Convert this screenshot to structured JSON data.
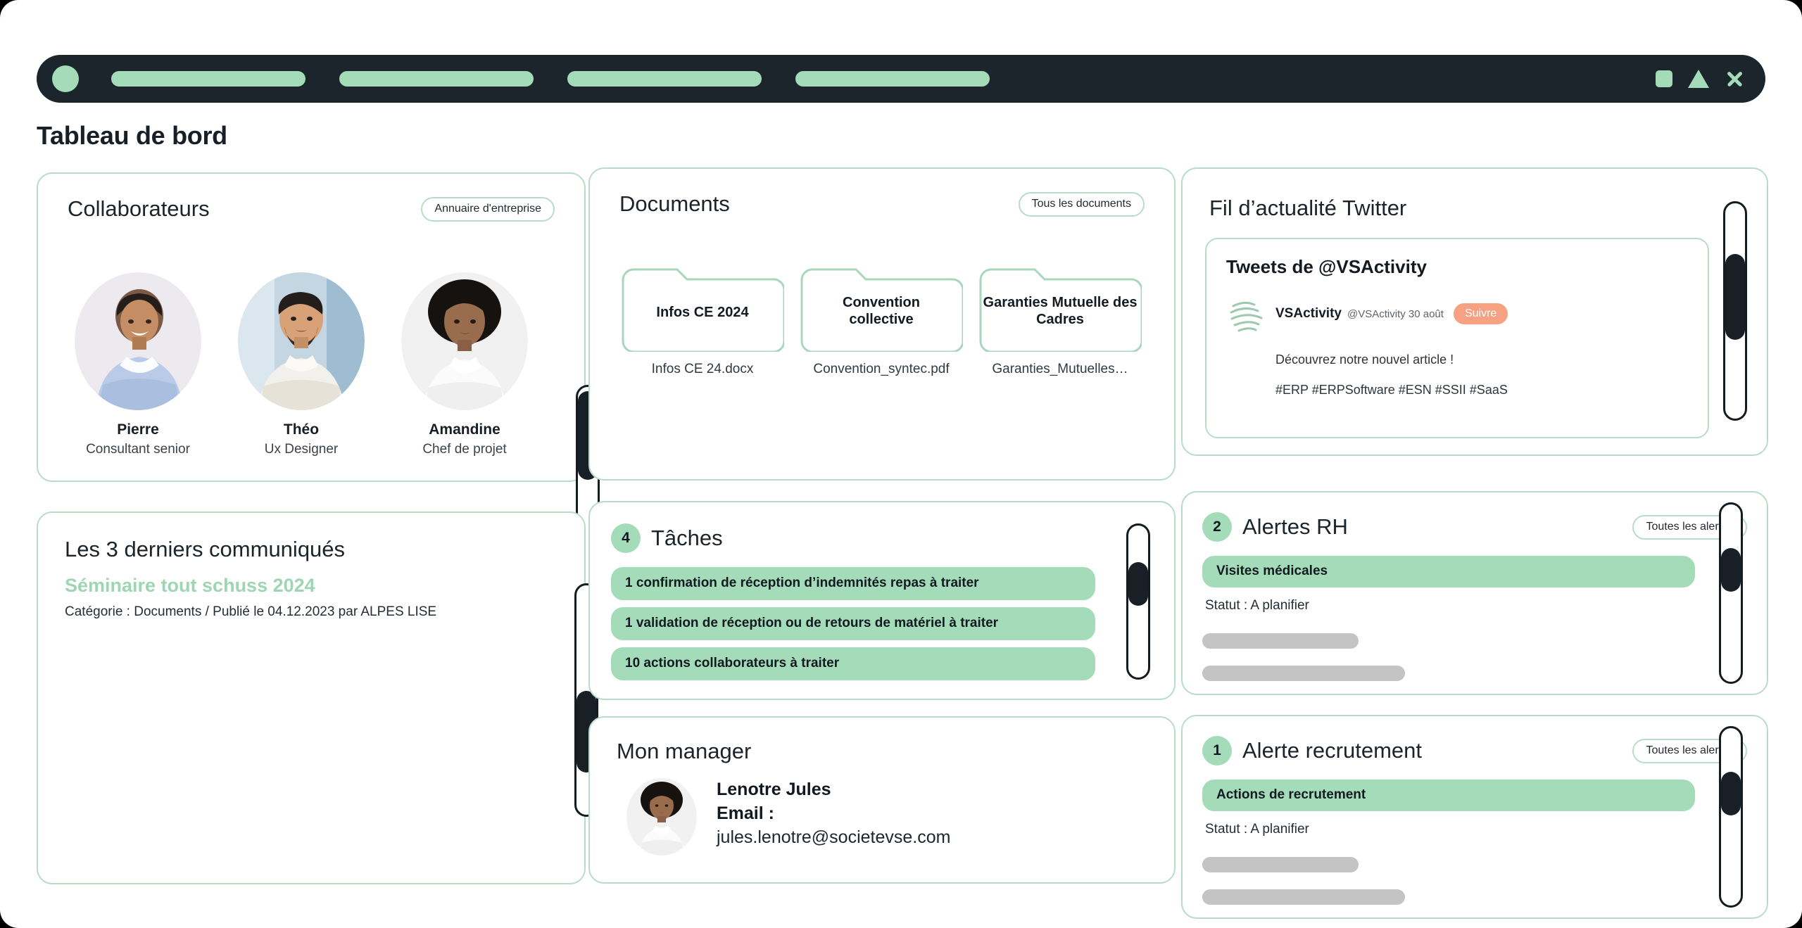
{
  "topbar": {
    "logo_name": "app-logo",
    "nav_items": [
      "nav-pill-1",
      "nav-pill-2",
      "nav-pill-3",
      "nav-pill-4"
    ],
    "window_square": "□",
    "window_triangle": "△",
    "window_close": "✕"
  },
  "page": {
    "title": "Tableau de bord"
  },
  "collaborateurs": {
    "title": "Collaborateurs",
    "chip": "Annuaire d'entreprise",
    "people": [
      {
        "name": "Pierre",
        "role": "Consultant senior"
      },
      {
        "name": "Théo",
        "role": "Ux Designer"
      },
      {
        "name": "Amandine",
        "role": "Chef de projet"
      }
    ]
  },
  "documents": {
    "title": "Documents",
    "chip": "Tous les documents",
    "folders": [
      {
        "label": "Infos CE 2024",
        "filename": "Infos CE 24.docx"
      },
      {
        "label": "Convention collective",
        "filename": "Convention_syntec.pdf"
      },
      {
        "label": "Garanties Mutuelle des Cadres",
        "filename": "Garanties_Mutuelles…"
      }
    ]
  },
  "twitter": {
    "title": "Fil d’actualité Twitter",
    "tweets_heading": "Tweets de @VSActivity",
    "user": "VSActivity",
    "handle": "@VSActivity 30 août",
    "follow_label": "Suivre",
    "body": "Découvrez notre nouvel article !",
    "tags": "#ERP #ERPSoftware #ESN #SSII #SaaS"
  },
  "communiques": {
    "title": "Les 3 derniers communiqués",
    "item_title": "Séminaire tout schuss 2024",
    "item_meta": "Catégorie : Documents / Publié le 04.12.2023 par ALPES LISE"
  },
  "taches": {
    "count": "4",
    "title": "Tâches",
    "items": [
      "1 confirmation de réception d’indemnités repas à traiter",
      "1 validation de réception ou de retours de matériel à traiter",
      "10 actions collaborateurs à traiter"
    ]
  },
  "manager": {
    "title": "Mon manager",
    "name": "Lenotre Jules",
    "email_label": "Email :",
    "email": "jules.lenotre@societevse.com"
  },
  "alertes_rh": {
    "count": "2",
    "title": "Alertes RH",
    "chip": "Toutes les alertes",
    "item": "Visites médicales",
    "status": "Statut : A planifier"
  },
  "alerte_recrutement": {
    "count": "1",
    "title": "Alerte recrutement",
    "chip": "Toutes les alertes",
    "item": "Actions de recrutement",
    "status": "Statut : A planifier"
  },
  "colors": {
    "mint": "#a4dcba",
    "mint_border": "#b7ddc8",
    "dark": "#1d252c",
    "coral": "#f7a183",
    "ghost": "#c4c4c4"
  }
}
